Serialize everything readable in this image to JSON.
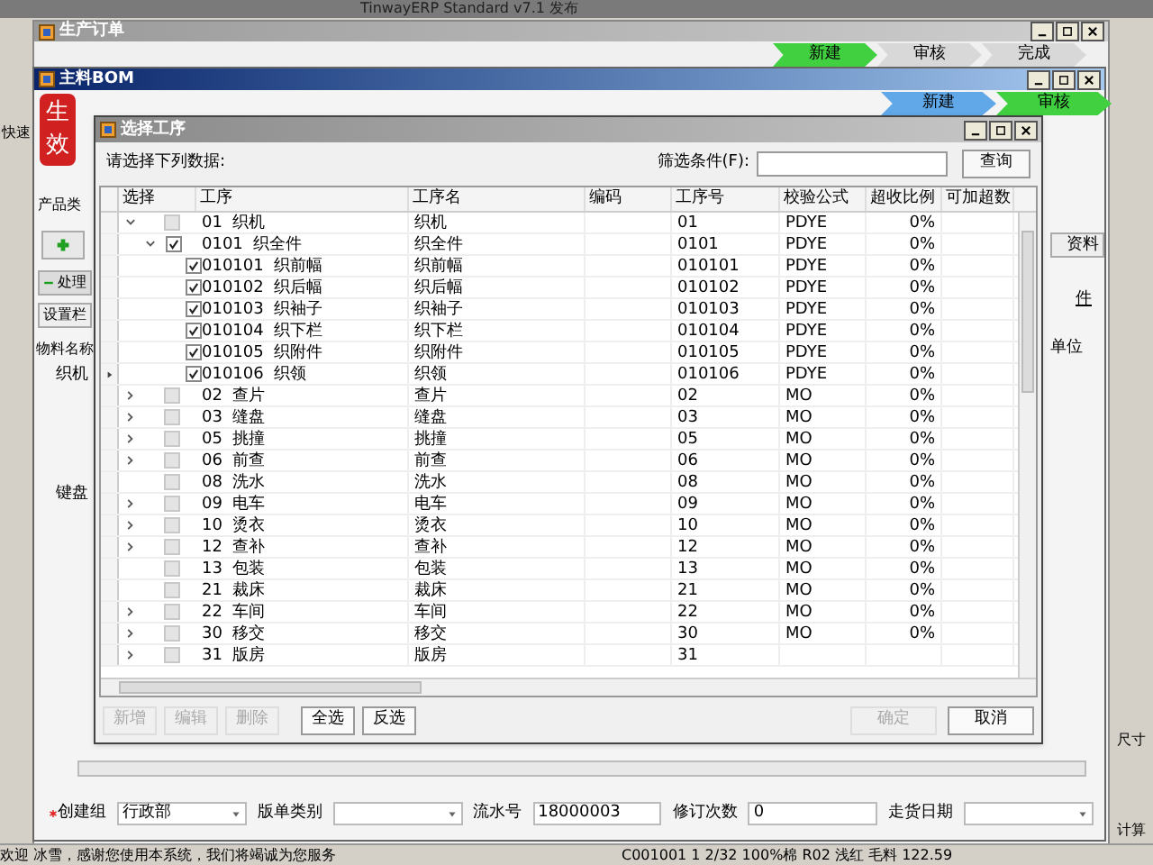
{
  "app": {
    "title": "TinwayERP Standard v7.1 发布",
    "quick": "快速",
    "side_labels": [
      "尺寸",
      "计算"
    ]
  },
  "order_window": {
    "title": "生产订单",
    "steps": [
      {
        "label": "新建",
        "color": "#40d040"
      },
      {
        "label": "审核",
        "color": "#d8d8d8"
      },
      {
        "label": "完成",
        "color": "#d8d8d8"
      }
    ]
  },
  "bom_window": {
    "title": "主料BOM",
    "stamp": "生效",
    "steps": [
      {
        "label": "新建",
        "color": "#60a8e8"
      },
      {
        "label": "审核",
        "color": "#40d040"
      }
    ],
    "left_panel": {
      "category_label": "产品类",
      "tab": "处理",
      "settings_button": "设置栏",
      "tree_header": "物料名称",
      "tree_items": [
        "织机",
        "键盘"
      ]
    },
    "right_panel": {
      "button": "资料",
      "tab": "件",
      "column": "单位"
    },
    "form": [
      {
        "label": "创建组",
        "value": "行政部",
        "required": true,
        "kind": "dropdown"
      },
      {
        "label": "版单类别",
        "kind": "dropdown"
      },
      {
        "label": "流水号",
        "value": "18000003",
        "kind": "text"
      },
      {
        "label": "修订次数",
        "value": "0",
        "kind": "text"
      },
      {
        "label": "走货日期",
        "kind": "dropdown"
      }
    ]
  },
  "dialog": {
    "title": "选择工序",
    "prompt": "请选择下列数据:",
    "filter": {
      "label": "筛选条件(F):"
    },
    "query_button": "查询",
    "columns": [
      "选择",
      "工序",
      "工序名",
      "编码",
      "工序号",
      "校验公式",
      "超收比例",
      "可加超数"
    ],
    "rows": [
      {
        "kind": "group",
        "expanded": true,
        "checked": false,
        "current": false,
        "code": "01",
        "name": "织机",
        "process_name": "织机",
        "process_no": "01",
        "formula": "PDYE",
        "ratio": "0%",
        "children": [
          {
            "kind": "group",
            "expanded": true,
            "checked": true,
            "current": false,
            "code": "0101",
            "name": "织全件",
            "process_name": "织全件",
            "process_no": "0101",
            "formula": "PDYE",
            "ratio": "0%",
            "children": [
              {
                "kind": "item",
                "checked": true,
                "current": false,
                "code": "010101",
                "name": "织前幅",
                "process_name": "织前幅",
                "process_no": "010101",
                "formula": "PDYE",
                "ratio": "0%"
              },
              {
                "kind": "item",
                "checked": true,
                "current": false,
                "code": "010102",
                "name": "织后幅",
                "process_name": "织后幅",
                "process_no": "010102",
                "formula": "PDYE",
                "ratio": "0%"
              },
              {
                "kind": "item",
                "checked": true,
                "current": false,
                "code": "010103",
                "name": "织袖子",
                "process_name": "织袖子",
                "process_no": "010103",
                "formula": "PDYE",
                "ratio": "0%"
              },
              {
                "kind": "item",
                "checked": true,
                "current": false,
                "code": "010104",
                "name": "织下栏",
                "process_name": "织下栏",
                "process_no": "010104",
                "formula": "PDYE",
                "ratio": "0%"
              },
              {
                "kind": "item",
                "checked": true,
                "current": false,
                "code": "010105",
                "name": "织附件",
                "process_name": "织附件",
                "process_no": "010105",
                "formula": "PDYE",
                "ratio": "0%"
              },
              {
                "kind": "item",
                "checked": true,
                "current": true,
                "code": "010106",
                "name": "织领",
                "process_name": "织领",
                "process_no": "010106",
                "formula": "PDYE",
                "ratio": "0%"
              }
            ]
          }
        ]
      },
      {
        "kind": "group",
        "expanded": false,
        "checked": false,
        "current": false,
        "code": "02",
        "name": "查片",
        "process_name": "查片",
        "process_no": "02",
        "formula": "MO",
        "ratio": "0%"
      },
      {
        "kind": "group",
        "expanded": false,
        "checked": false,
        "current": false,
        "code": "03",
        "name": "缝盘",
        "process_name": "缝盘",
        "process_no": "03",
        "formula": "MO",
        "ratio": "0%"
      },
      {
        "kind": "group",
        "expanded": false,
        "checked": false,
        "current": false,
        "code": "05",
        "name": "挑撞",
        "process_name": "挑撞",
        "process_no": "05",
        "formula": "MO",
        "ratio": "0%"
      },
      {
        "kind": "group",
        "expanded": false,
        "checked": false,
        "current": false,
        "code": "06",
        "name": "前查",
        "process_name": "前查",
        "process_no": "06",
        "formula": "MO",
        "ratio": "0%"
      },
      {
        "kind": "item",
        "checked": false,
        "current": false,
        "code": "08",
        "name": "洗水",
        "process_name": "洗水",
        "process_no": "08",
        "formula": "MO",
        "ratio": "0%"
      },
      {
        "kind": "group",
        "expanded": false,
        "checked": false,
        "current": false,
        "code": "09",
        "name": "电车",
        "process_name": "电车",
        "process_no": "09",
        "formula": "MO",
        "ratio": "0%"
      },
      {
        "kind": "group",
        "expanded": false,
        "checked": false,
        "current": false,
        "code": "10",
        "name": "烫衣",
        "process_name": "烫衣",
        "process_no": "10",
        "formula": "MO",
        "ratio": "0%"
      },
      {
        "kind": "group",
        "expanded": false,
        "checked": false,
        "current": false,
        "code": "12",
        "name": "查补",
        "process_name": "查补",
        "process_no": "12",
        "formula": "MO",
        "ratio": "0%"
      },
      {
        "kind": "item",
        "checked": false,
        "current": false,
        "code": "13",
        "name": "包装",
        "process_name": "包装",
        "process_no": "13",
        "formula": "MO",
        "ratio": "0%"
      },
      {
        "kind": "item",
        "checked": false,
        "current": false,
        "code": "21",
        "name": "裁床",
        "process_name": "裁床",
        "process_no": "21",
        "formula": "MO",
        "ratio": "0%"
      },
      {
        "kind": "group",
        "expanded": false,
        "checked": false,
        "current": false,
        "code": "22",
        "name": "车间",
        "process_name": "车间",
        "process_no": "22",
        "formula": "MO",
        "ratio": "0%"
      },
      {
        "kind": "group",
        "expanded": false,
        "checked": false,
        "current": false,
        "code": "30",
        "name": "移交",
        "process_name": "移交",
        "process_no": "30",
        "formula": "MO",
        "ratio": "0%"
      },
      {
        "kind": "group",
        "expanded": false,
        "checked": false,
        "current": false,
        "code": "31",
        "name": "版房",
        "process_name": "版房",
        "process_no": "31"
      }
    ],
    "buttons": [
      {
        "label": "新增",
        "disabled": true
      },
      {
        "label": "编辑",
        "disabled": true
      },
      {
        "label": "删除",
        "disabled": true
      },
      {
        "label": "全选",
        "disabled": false
      },
      {
        "label": "反选",
        "disabled": false
      }
    ],
    "confirm_buttons": [
      {
        "label": "确定",
        "disabled": true
      },
      {
        "label": "取消",
        "disabled": false
      }
    ]
  },
  "status_bar": {
    "message": "欢迎 冰雪，感谢您使用本系统，我们将竭诚为您服务",
    "detail": "C001001 1 2/32 100%棉 R02 浅红 毛料 122.59"
  }
}
